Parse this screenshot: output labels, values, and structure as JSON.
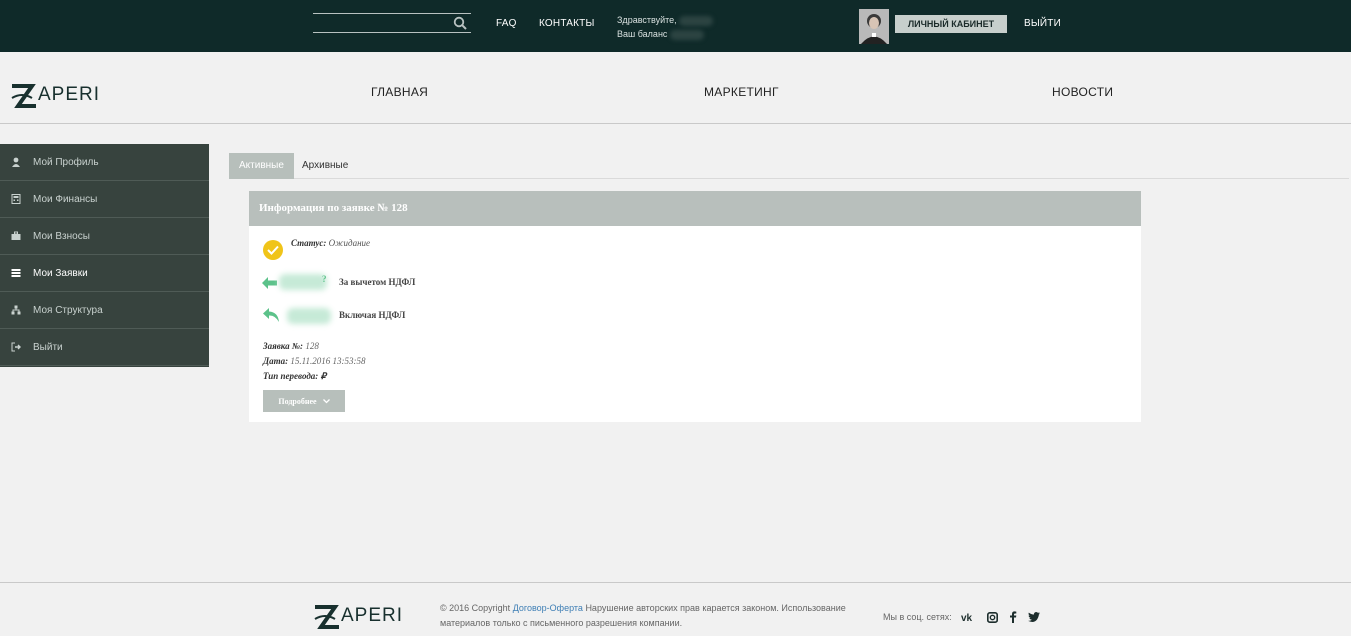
{
  "topbar": {
    "search_placeholder": "",
    "faq": "FAQ",
    "contacts": "КОНТАКТЫ",
    "greeting": "Здравствуйте,",
    "balance": "Ваш баланс",
    "cabinet_button": "ЛИЧНЫЙ КАБИНЕТ",
    "logout": "ВЫЙТИ"
  },
  "header": {
    "logo_text": "ZAPERI",
    "nav": [
      "ГЛАВНАЯ",
      "МАРКЕТИНГ",
      "НОВОСТИ"
    ]
  },
  "sidebar": {
    "items": [
      {
        "label": "Мой Профиль",
        "icon": "user-icon"
      },
      {
        "label": "Мои Финансы",
        "icon": "calculator-icon"
      },
      {
        "label": "Мои Взносы",
        "icon": "briefcase-icon"
      },
      {
        "label": "Мои Заявки",
        "icon": "list-icon",
        "active": true
      },
      {
        "label": "Моя Структура",
        "icon": "sitemap-icon"
      },
      {
        "label": "Выйти",
        "icon": "sign-out-icon"
      }
    ]
  },
  "tabs": [
    {
      "label": "Активные",
      "active": true
    },
    {
      "label": "Архивные",
      "active": false
    }
  ],
  "request": {
    "title": "Информация по заявке № 128",
    "status_label": "Статус:",
    "status_value": "Ожидание",
    "net_suffix": "?",
    "net_label": "За вычетом НДФЛ",
    "gross_label": "Включая НДФЛ",
    "number_label": "Заявка №:",
    "number_value": "128",
    "date_label": "Дата:",
    "date_value": "15.11.2016 13:53:58",
    "type_label": "Тип перевода:",
    "type_value": "₽",
    "more_button": "Подробнее"
  },
  "footer": {
    "logo_text": "ZAPERI",
    "copyright_prefix": "© 2016 Copyright",
    "offer_link": "Договор-Оферта",
    "copyright_suffix": "Нарушение авторских прав карается законом. Использование материалов только с письменного разрешения компании.",
    "social_label": "Мы в соц. сетях:",
    "social_icons": [
      "vk-icon",
      "instagram-icon",
      "facebook-icon",
      "twitter-icon"
    ]
  },
  "colors": {
    "topbar_bg": "#0f2a29",
    "sidebar_bg": "#37433e",
    "accent_gray": "#b8bfbc",
    "status_yellow": "#f0c419",
    "arrow_green": "#5cc28a",
    "link_blue": "#3f7fb5"
  }
}
